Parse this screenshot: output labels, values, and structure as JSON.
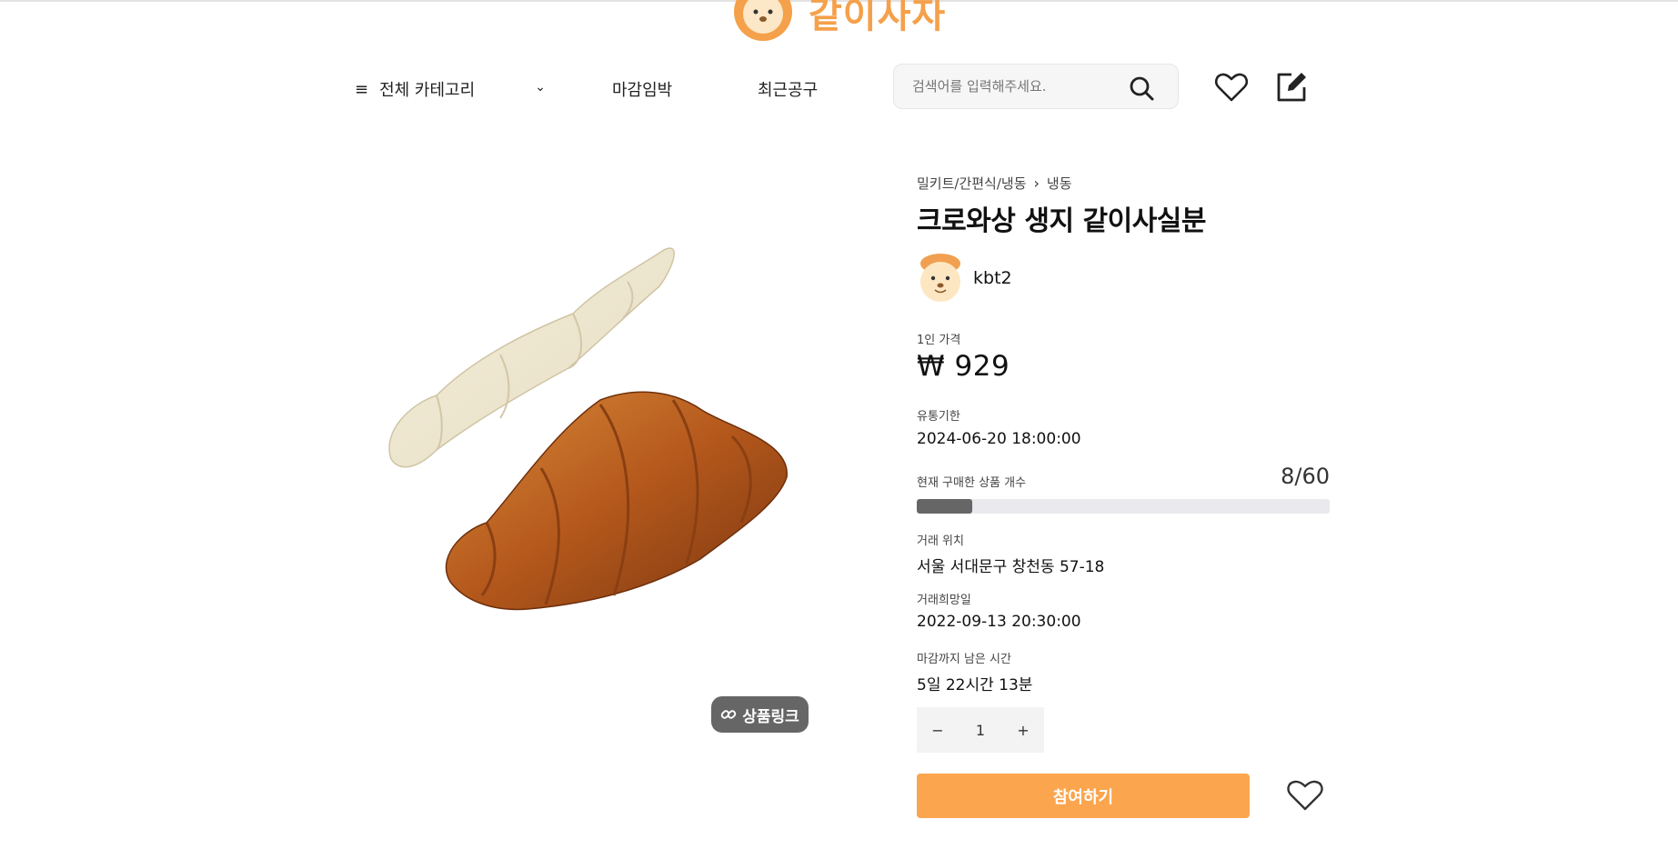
{
  "brand": {
    "name": "같이사자",
    "logo_icon": "lion-logo-icon",
    "accent_color": "#f5a04a"
  },
  "nav": {
    "category_label": "전체 카테고리",
    "menu_icon": "hamburger-icon",
    "menu_glyph": "≡",
    "chevron_icon": "chevron-down-icon",
    "chevron_glyph": "⌄",
    "deadline_label": "마감임박",
    "recent_label": "최근공구",
    "search_placeholder": "검색어를 입력해주세요.",
    "search_icon": "search-icon",
    "heart_icon": "heart-icon",
    "edit_icon": "edit-icon"
  },
  "product": {
    "image_alt": "crossaint-image",
    "link_badge_label": "상품링크",
    "link_icon": "link-icon",
    "breadcrumb": [
      "밀키트/간편식/냉동",
      "냉동"
    ],
    "breadcrumb_sep": "›",
    "title": "크로와상 생지 같이사실분",
    "seller_name": "kbt2",
    "price_label": "1인 가격",
    "price": "₩ 929",
    "expiry_label": "유통기한",
    "expiry": "2024-06-20 18:00:00",
    "count_label": "현재 구매한 상품 개수",
    "count_value": "8/60",
    "count_current": 8,
    "count_total": 60,
    "location_label": "거래 위치",
    "location": "서울 서대문구 창천동 57-18",
    "date_label": "거래희망일",
    "date": "2022-09-13 20:30:00",
    "remaining_label": "마감까지 남은 시간",
    "remaining": "5일 22시간 13분",
    "quantity": "1",
    "minus_label": "−",
    "plus_label": "+",
    "join_label": "참여하기",
    "join_color": "#fba54e"
  }
}
